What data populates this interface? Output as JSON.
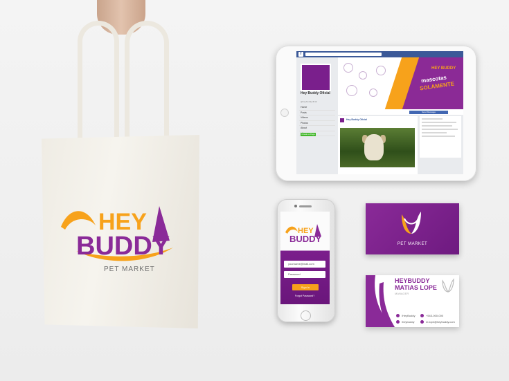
{
  "tote": {
    "logo_word1": "HEY",
    "logo_word2": "BUDDY",
    "subtitle": "PET MARKET"
  },
  "tablet": {
    "page_name": "Hey Buddy Oficial",
    "handle": "@heybuddyoficial",
    "menu": [
      "Home",
      "Posts",
      "Videos",
      "Photos",
      "About",
      "Likes"
    ],
    "create_page": "Create a Page",
    "send_message": "Send Message",
    "cover_brand": "HEY BUDDY",
    "cover_line1": "mascotas",
    "cover_line2": "SOLAMENTE",
    "post_author": "Hey Buddy Oficial"
  },
  "phone": {
    "logo_word1": "HEY",
    "logo_word2": "BUDDY",
    "email_placeholder": "yourname@mail.com",
    "password_placeholder": "Password",
    "signin_label": "Sign In",
    "forgot_label": "Forgot Password?"
  },
  "purple_card": {
    "label": "PET MARKET"
  },
  "white_card": {
    "brand": "HEYBUDDY",
    "name": "MATIAS LOPE",
    "title": "MANAGER",
    "contacts": [
      {
        "icon": "facebook-icon",
        "text": "/HeyBuddy"
      },
      {
        "icon": "instagram-icon",
        "text": "/heybuddy"
      },
      {
        "icon": "phone-icon",
        "text": "+543-000-000"
      },
      {
        "icon": "email-icon",
        "text": "m.lope@heybuddy.com"
      }
    ]
  },
  "colors": {
    "purple": "#8a2a98",
    "orange": "#f7a21b",
    "facebook_blue": "#3b5998"
  }
}
